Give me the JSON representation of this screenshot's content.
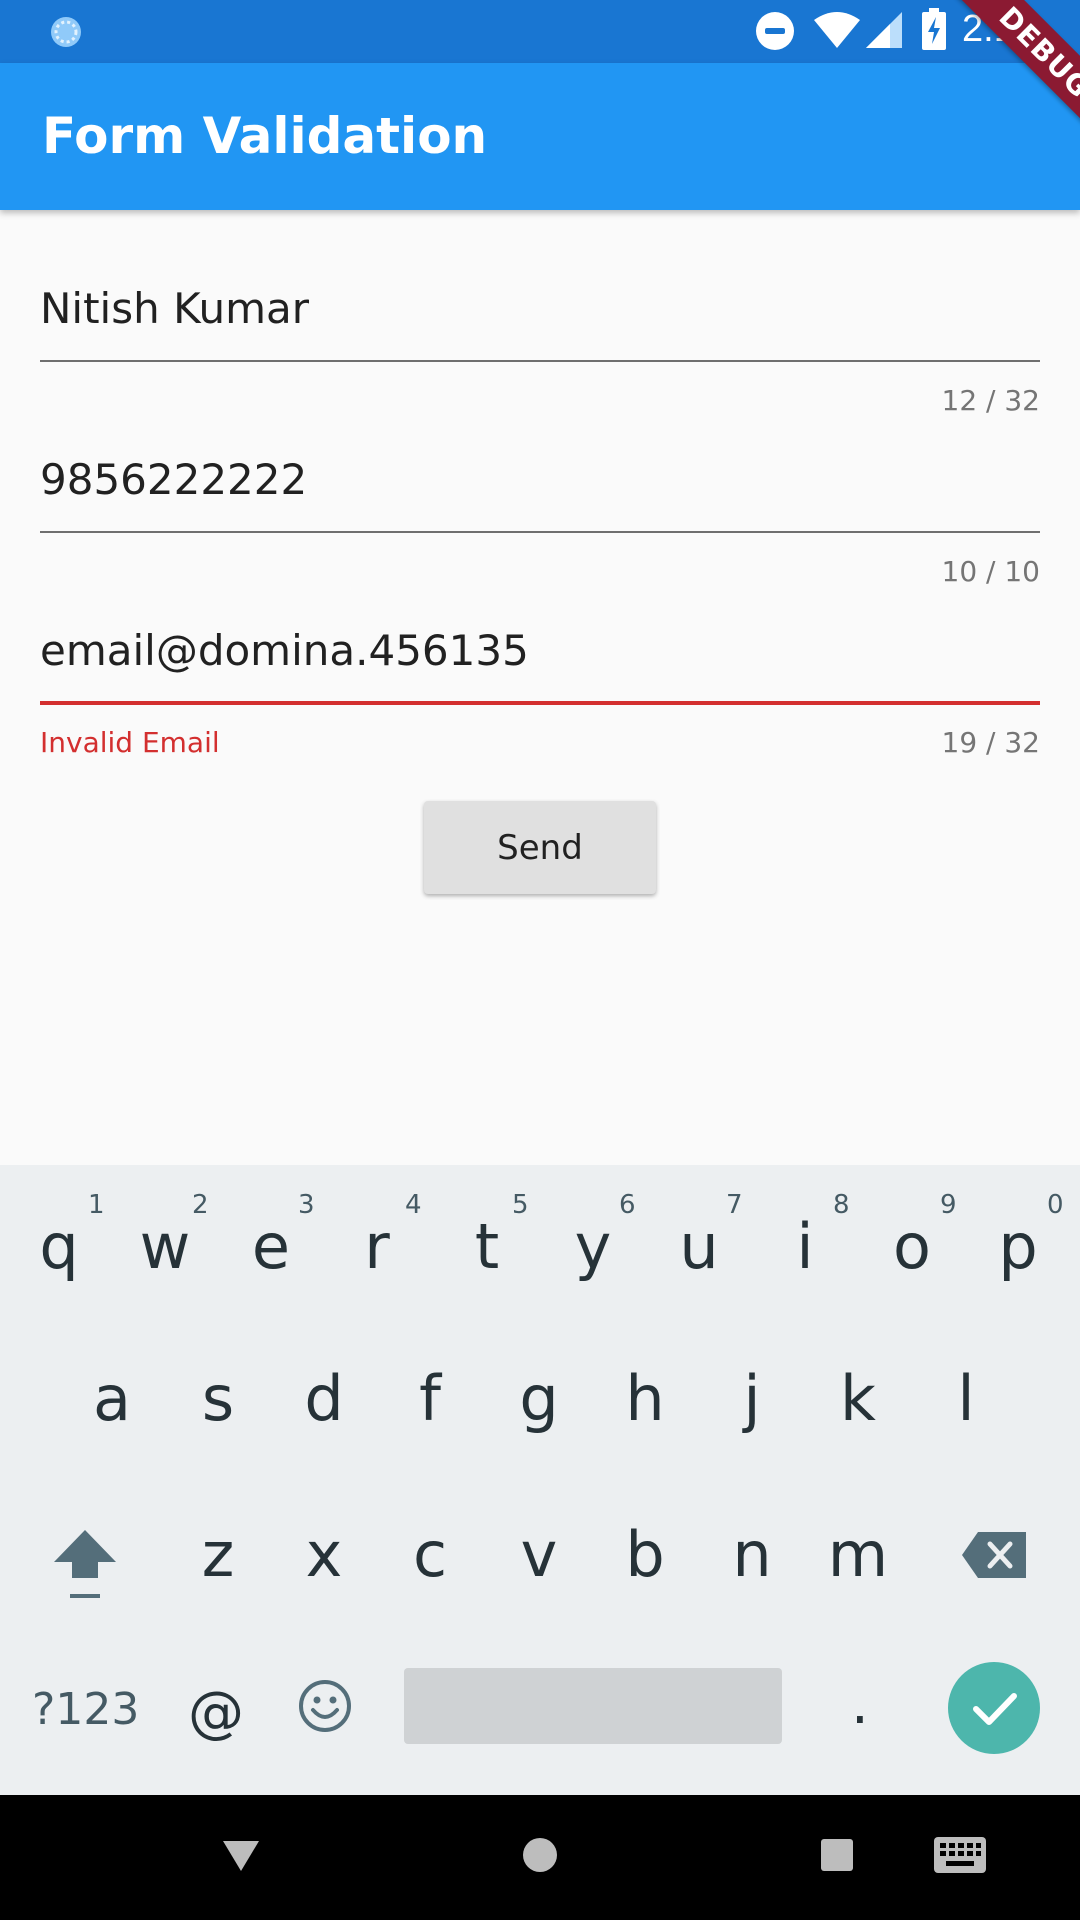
{
  "status_bar": {
    "time": "2:11"
  },
  "app_bar": {
    "title": "Form Validation",
    "debug_label": "DEBUG"
  },
  "form": {
    "name_value": "Nitish Kumar",
    "name_counter": "12 / 32",
    "phone_value": "9856222222",
    "phone_counter": "10 / 10",
    "email_value": "email@domina.456135",
    "email_counter": "19 / 32",
    "email_error": "Invalid Email",
    "send_label": "Send"
  },
  "keyboard": {
    "row1": [
      "q",
      "w",
      "e",
      "r",
      "t",
      "y",
      "u",
      "i",
      "o",
      "p"
    ],
    "row1_hints": [
      "1",
      "2",
      "3",
      "4",
      "5",
      "6",
      "7",
      "8",
      "9",
      "0"
    ],
    "row2": [
      "a",
      "s",
      "d",
      "f",
      "g",
      "h",
      "j",
      "k",
      "l"
    ],
    "row3": [
      "z",
      "x",
      "c",
      "v",
      "b",
      "n",
      "m"
    ],
    "symbols_label": "?123",
    "at_label": "@",
    "period_label": "."
  },
  "colors": {
    "status_bar": "#1976d2",
    "app_bar": "#2196f3",
    "error": "#d32f2f",
    "enter_key": "#4db6ac"
  }
}
